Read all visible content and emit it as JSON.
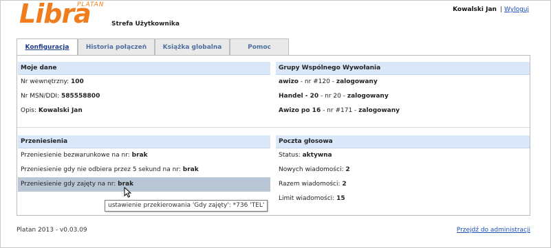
{
  "header": {
    "logo_word": "Libra",
    "logo_small": "PLATAN",
    "zone_label": "Strefa Użytkownika",
    "user_name": "Kowalski Jan",
    "separator": "|",
    "logout_label": "Wyloguj"
  },
  "tabs": [
    {
      "label": "Konfiguracja",
      "active": true
    },
    {
      "label": "Historia połączeń",
      "active": false
    },
    {
      "label": "Książka globalna",
      "active": false
    },
    {
      "label": "Pomoc",
      "active": false
    }
  ],
  "moje_dane": {
    "title": "Moje dane",
    "rows": [
      {
        "label": "Nr wewnętrzny:",
        "value": "100"
      },
      {
        "label": "Nr MSN/DDI:",
        "value": "585558800"
      },
      {
        "label": "Opis:",
        "value": "Kowalski Jan"
      }
    ]
  },
  "grupy": {
    "title": "Grupy Wspólnego Wywołania",
    "rows": [
      {
        "name": "awizo",
        "mid": " - nr #120 - ",
        "status": "zalogowany"
      },
      {
        "name": "Handel - 20",
        "mid": " - nr 20 - ",
        "status": "zalogowany"
      },
      {
        "name": "Awizo po 16",
        "mid": " - nr #171 - ",
        "status": "zalogowany"
      }
    ]
  },
  "przeniesienia": {
    "title": "Przeniesienia",
    "rows": [
      {
        "label": "Przeniesienie bezwarunkowe na nr:",
        "value": "brak",
        "highlighted": false
      },
      {
        "label": "Przeniesienie gdy nie odbiera przez 5 sekund na nr:",
        "value": "brak",
        "highlighted": false
      },
      {
        "label": "Przeniesienie gdy zajęty na nr:",
        "value": "brak",
        "highlighted": true
      }
    ]
  },
  "poczta": {
    "title": "Poczta głosowa",
    "rows": [
      {
        "label": "Status:",
        "value": "aktywna"
      },
      {
        "label": "Nowych wiadomości:",
        "value": "2"
      },
      {
        "label": "Razem wiadomości:",
        "value": "2"
      },
      {
        "label": "Limit wiadomości:",
        "value": "15"
      }
    ]
  },
  "tooltip": {
    "text": "ustawienie przekierowania 'Gdy zajęty': *736 'TEL'"
  },
  "footer": {
    "version": "Platan 2013 - v0.03.09",
    "admin_link": "Przejdź do administracji"
  },
  "colors": {
    "brand_orange": "#ef7d1d",
    "box_header": "#d9e7f8",
    "row_highlight": "#b8c6d6",
    "link": "#1a4fb8"
  },
  "icons": {
    "cursor": "mouse-pointer-icon"
  }
}
